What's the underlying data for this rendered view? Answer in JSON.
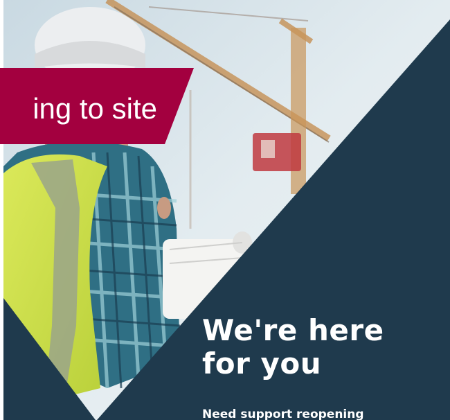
{
  "banner": {
    "text": "ing to site",
    "color": "#a3003f"
  },
  "headline": {
    "line1": "We're here",
    "line2": "for you"
  },
  "subtext": "Need support reopening",
  "colors": {
    "navy": "#1f3a4d",
    "sky": "#dfe9ee",
    "hivis": "#d6e74a"
  }
}
